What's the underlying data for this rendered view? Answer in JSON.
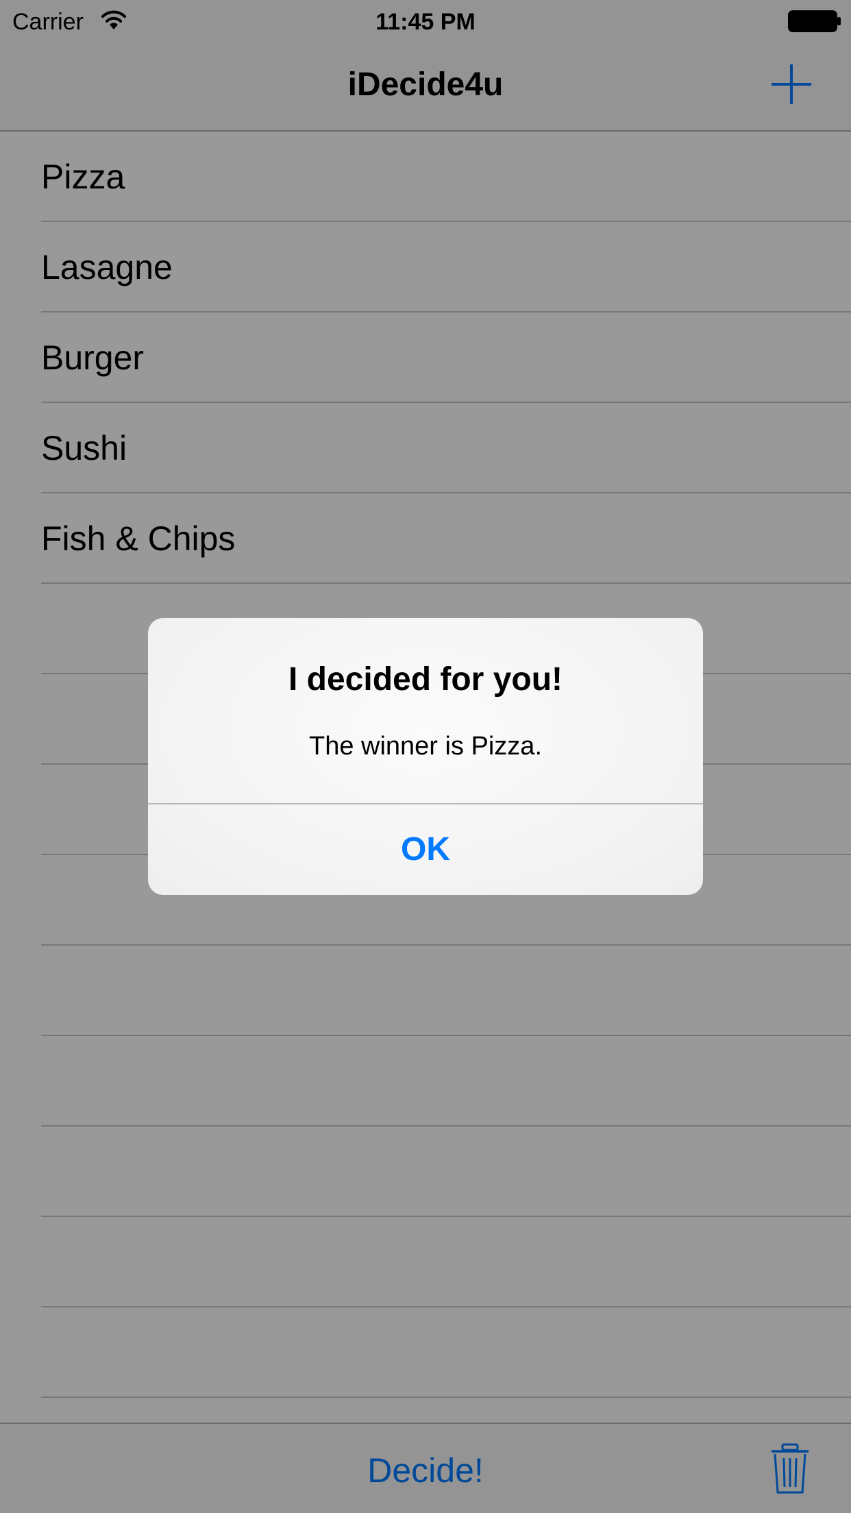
{
  "status_bar": {
    "carrier": "Carrier",
    "time": "11:45 PM",
    "icons": [
      "wifi-icon",
      "battery-icon"
    ]
  },
  "nav_bar": {
    "title": "iDecide4u",
    "add_icon": "plus-icon"
  },
  "table": {
    "items": [
      {
        "label": "Pizza"
      },
      {
        "label": "Lasagne"
      },
      {
        "label": "Burger"
      },
      {
        "label": "Sushi"
      },
      {
        "label": "Fish & Chips"
      },
      {
        "label": ""
      },
      {
        "label": ""
      },
      {
        "label": ""
      },
      {
        "label": ""
      },
      {
        "label": ""
      },
      {
        "label": ""
      },
      {
        "label": ""
      },
      {
        "label": ""
      },
      {
        "label": ""
      }
    ]
  },
  "toolbar": {
    "decide_label": "Decide!",
    "trash_icon": "trash-icon"
  },
  "alert": {
    "title": "I decided for you!",
    "message": "The winner is Pizza.",
    "ok_label": "OK"
  },
  "colors": {
    "tint": "#007aff",
    "bar_background": "#f7f7f7",
    "separator": "#c8c7cc",
    "dim_overlay": "rgba(0,0,0,0.40)"
  }
}
